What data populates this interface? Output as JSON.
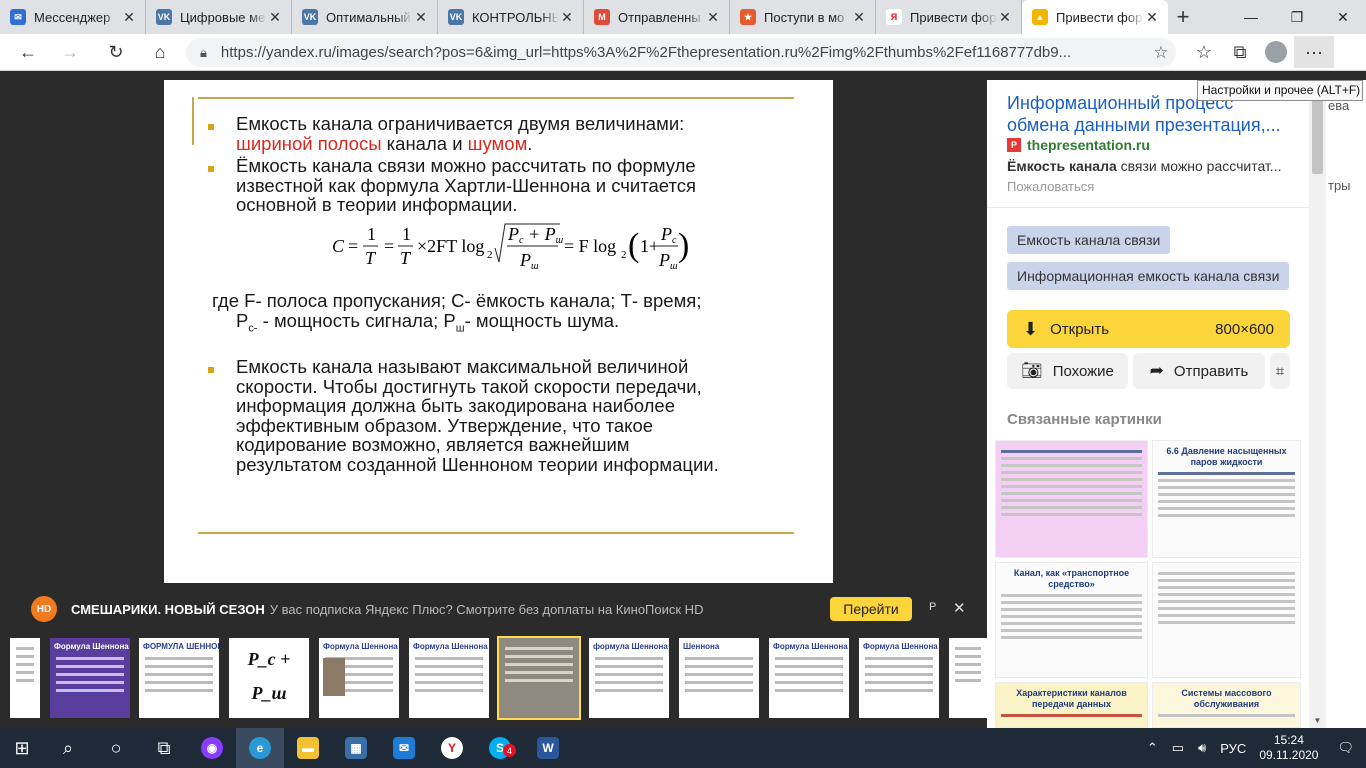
{
  "tabs": [
    {
      "title": "Мессенджер",
      "icon": "messenger-icon",
      "color": "#2f6fd6",
      "glyph": "✉"
    },
    {
      "title": "Цифровые ме",
      "icon": "vk-icon",
      "color": "#4a76a8",
      "glyph": "VK"
    },
    {
      "title": "Оптимальный",
      "icon": "vk-icon",
      "color": "#4a76a8",
      "glyph": "VK"
    },
    {
      "title": "КОНТРОЛЬНЫ",
      "icon": "vk-icon",
      "color": "#4a76a8",
      "glyph": "VK"
    },
    {
      "title": "Отправленны",
      "icon": "gmail-icon",
      "color": "#e04a3b",
      "glyph": "M"
    },
    {
      "title": "Поступи в мо",
      "icon": "star-logo-icon",
      "color": "#e65c2e",
      "glyph": "★"
    },
    {
      "title": "Привести фор",
      "icon": "yandex-icon",
      "color": "#ffffff",
      "glyph": "Я"
    },
    {
      "title": "Привести фор",
      "icon": "yandex-images-icon",
      "color": "#f2b600",
      "glyph": "▲"
    }
  ],
  "address": {
    "url": "https://yandex.ru/images/search?pos=6&img_url=https%3A%2F%2Fthepresentation.ru%2Fimg%2Fthumbs%2Fef1168777db9..."
  },
  "tooltip": "Настройки и прочее (ALT+F)",
  "slide": {
    "b1_l1": "Емкость канала ограничивается двумя величинами:",
    "b1_red1": "шириной полосы",
    "b1_mid": " канала и ",
    "b1_red2": "шумом",
    "b1_end": ".",
    "b2_l1": "Ёмкость канала связи можно рассчитать по формуле",
    "b2_l2": "известной как формула Хартли-Шеннона и считается",
    "b2_l3": "основной в теории информации.",
    "where_l1": "где F- полоса пропускания; С- ёмкость канала; Т- время;",
    "where_l2": "Р",
    "where_sub1": "с-",
    "where_l2b": " - мощность сигнала; Р",
    "where_sub2": "ш",
    "where_l2c": "- мощность шума.",
    "b3_l1": "Емкость канала называют максимальной величиной",
    "b3_l2": "скорости. Чтобы достигнуть такой скорости передачи,",
    "b3_l3": "информация должна быть закодирована наиболее",
    "b3_l4": "эффективным образом. Утверждение, что такое",
    "b3_l5": "кодирование возможно, является важнейшим",
    "b3_l6": "результатом созданной Шенноном теории информации."
  },
  "panel": {
    "title": "Информационный процесс обмена данными презентация,...",
    "source": "thepresentation.ru",
    "snippet_bold": "Ёмкость канала",
    "snippet_rest": " связи можно рассчитат...",
    "complain": "Пожаловаться",
    "chip1": "Емкость канала связи",
    "chip2": "Информационная емкость канала связи",
    "open_label": "Открыть",
    "open_size": "800×600",
    "similar": "Похожие",
    "share": "Отправить",
    "related": "Связанные картинки",
    "thumb_headers": [
      "6.6 Давление насыщенных паров жидкости",
      "Канал, как «транспортное средство»",
      "Характеристики каналов передачи данных",
      "Системы массового обслуживания"
    ]
  },
  "bg_strip": [
    "ева",
    "тры"
  ],
  "promo": {
    "title": "СМЕШАРИКИ. НОВЫЙ СЕЗОН",
    "text": "У вас подписка Яндекс Плюс? Смотрите без доплаты на КиноПоиск HD",
    "button": "Перейти",
    "r": "Р"
  },
  "film": [
    {
      "title": "",
      "kind": "lines"
    },
    {
      "title": "Формула Шеннона",
      "kind": "purple"
    },
    {
      "title": "ФОРМУЛА ШЕННОНА",
      "kind": "lines"
    },
    {
      "title": "",
      "kind": "big"
    },
    {
      "title": "Формула Шеннона",
      "kind": "portrait"
    },
    {
      "title": "Формула Шеннона",
      "kind": "lines"
    },
    {
      "title": "",
      "kind": "selected"
    },
    {
      "title": "формула Шеннона",
      "kind": "lines"
    },
    {
      "title": "Шеннона",
      "kind": "lines"
    },
    {
      "title": "Формула Шеннона",
      "kind": "lines"
    },
    {
      "title": "Формула Шеннона",
      "kind": "lines"
    },
    {
      "title": "",
      "kind": "lines"
    }
  ],
  "film_big": "P_c + P_ш",
  "film_big2": "P_ш",
  "taskbar": {
    "lang": "РУС",
    "time": "15:24",
    "date": "09.11.2020",
    "skype_badge": "4"
  }
}
